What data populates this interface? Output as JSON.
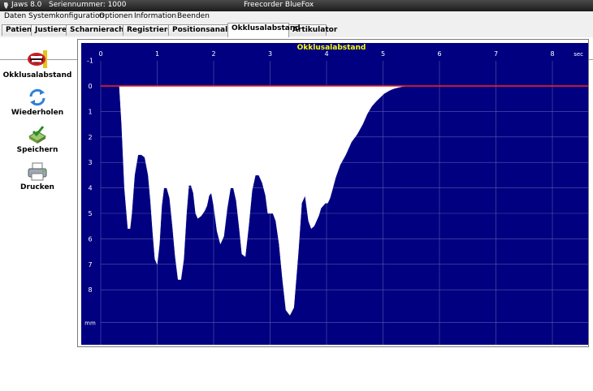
{
  "window": {
    "title": "Jaws 8.0   Seriennummer: 1000",
    "device": "Freecorder BlueFox"
  },
  "menu": [
    "Daten",
    "Systemkonfiguration",
    "Optionen",
    "Information",
    "Beenden"
  ],
  "tabs": [
    {
      "label": "Patient",
      "active": false
    },
    {
      "label": "Justieren",
      "active": false
    },
    {
      "label": "Scharnierachse",
      "active": false
    },
    {
      "label": "Registrieren",
      "active": false
    },
    {
      "label": "Positionsanalyse",
      "active": false
    },
    {
      "label": "Okklusalabstand",
      "active": true
    },
    {
      "label": "Artikulator",
      "active": false
    }
  ],
  "sidebar": {
    "okklusal": "Okklusalabstand",
    "reload": "Wiederholen",
    "save": "Speichern",
    "print": "Drucken"
  },
  "colors": {
    "plot_bg": "#000080",
    "grid": "#5a5ab0",
    "title": "#ffff00",
    "zero_line": "#ff2020",
    "fill": "#ffffff"
  },
  "chart_data": {
    "type": "area",
    "title": "Okklusalabstand",
    "x_unit": "sec",
    "y_unit": "mm",
    "xlim": [
      0,
      8.6
    ],
    "ylim": [
      -1,
      9
    ],
    "y_inverted": true,
    "x_ticks": [
      0,
      1,
      2,
      3,
      4,
      5,
      6,
      7,
      8
    ],
    "y_ticks": [
      -1,
      0,
      1,
      2,
      3,
      4,
      5,
      6,
      7,
      8
    ],
    "zero_line": 0,
    "series": [
      {
        "x": [
          0.0,
          0.25,
          0.33,
          0.37,
          0.42,
          0.48,
          0.52,
          0.55,
          0.6,
          0.66,
          0.72,
          0.78,
          0.84,
          0.88,
          0.92,
          0.96,
          1.0,
          1.04,
          1.08,
          1.12,
          1.17,
          1.22,
          1.27,
          1.32,
          1.37,
          1.42,
          1.47,
          1.52,
          1.56,
          1.6,
          1.64,
          1.68,
          1.72,
          1.78,
          1.84,
          1.88,
          1.92,
          1.96,
          2.0,
          2.06,
          2.12,
          2.18,
          2.24,
          2.3,
          2.35,
          2.4,
          2.45,
          2.5,
          2.56,
          2.62,
          2.68,
          2.74,
          2.8,
          2.86,
          2.92,
          2.96,
          3.0,
          3.05,
          3.1,
          3.16,
          3.22,
          3.28,
          3.35,
          3.42,
          3.5,
          3.56,
          3.62,
          3.68,
          3.73,
          3.78,
          3.82,
          3.86,
          3.9,
          3.94,
          3.98,
          4.02,
          4.06,
          4.1,
          4.16,
          4.24,
          4.34,
          4.44,
          4.54,
          4.64,
          4.72,
          4.8,
          4.88,
          4.95,
          5.02,
          5.08,
          5.14,
          5.2,
          5.28,
          5.35,
          5.42,
          5.5,
          5.56,
          8.6
        ],
        "y": [
          0.0,
          0.0,
          0.0,
          1.5,
          4.0,
          5.6,
          5.6,
          5.0,
          3.5,
          2.7,
          2.7,
          2.8,
          3.5,
          4.5,
          5.7,
          6.8,
          7.0,
          6.2,
          4.7,
          4.0,
          4.0,
          4.4,
          5.5,
          6.7,
          7.6,
          7.6,
          6.8,
          5.0,
          3.9,
          3.9,
          4.2,
          5.0,
          5.2,
          5.1,
          4.9,
          4.7,
          4.3,
          4.2,
          4.7,
          5.7,
          6.2,
          5.9,
          4.8,
          4.0,
          4.0,
          4.5,
          5.5,
          6.6,
          6.7,
          5.5,
          4.1,
          3.5,
          3.5,
          3.8,
          4.3,
          5.0,
          5.0,
          5.0,
          5.3,
          6.2,
          7.6,
          8.8,
          9.0,
          8.7,
          6.5,
          4.6,
          4.3,
          5.3,
          5.6,
          5.5,
          5.3,
          5.1,
          4.8,
          4.7,
          4.6,
          4.6,
          4.4,
          4.1,
          3.6,
          3.1,
          2.7,
          2.2,
          1.9,
          1.5,
          1.1,
          0.8,
          0.6,
          0.45,
          0.3,
          0.22,
          0.15,
          0.1,
          0.05,
          0.02,
          0.0,
          0.0,
          0.0,
          0.0
        ]
      }
    ]
  }
}
